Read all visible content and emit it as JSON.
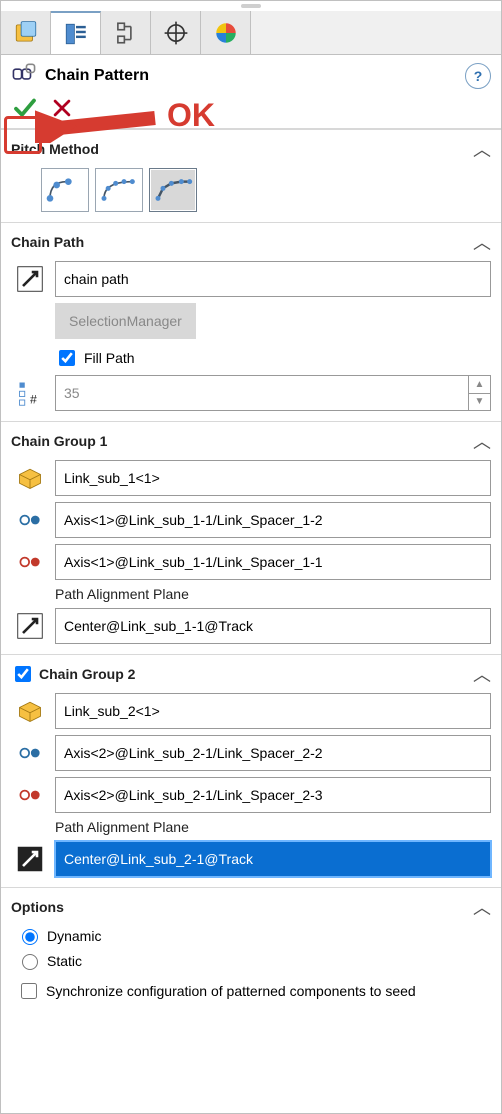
{
  "feature": {
    "title": "Chain Pattern",
    "help": "?"
  },
  "annotation": {
    "label": "OK"
  },
  "sections": {
    "pitch": {
      "title": "Pitch Method"
    },
    "path": {
      "title": "Chain Path",
      "path_value": "chain path",
      "selmgr_label": "SelectionManager",
      "fill_label": "Fill Path",
      "fill_checked": true,
      "count_value": "35"
    },
    "group1": {
      "title": "Chain Group 1",
      "component": "Link_sub_1<1>",
      "link1": "Axis<1>@Link_sub_1-1/Link_Spacer_1-2",
      "link2": "Axis<1>@Link_sub_1-1/Link_Spacer_1-1",
      "align_label": "Path Alignment Plane",
      "align_value": "Center@Link_sub_1-1@Track"
    },
    "group2": {
      "title": "Chain Group 2",
      "enabled": true,
      "component": "Link_sub_2<1>",
      "link1": "Axis<2>@Link_sub_2-1/Link_Spacer_2-2",
      "link2": "Axis<2>@Link_sub_2-1/Link_Spacer_2-3",
      "align_label": "Path Alignment Plane",
      "align_value": "Center@Link_sub_2-1@Track"
    },
    "options": {
      "title": "Options",
      "dynamic_label": "Dynamic",
      "static_label": "Static",
      "sync_label": "Synchronize configuration of patterned components to seed"
    }
  }
}
